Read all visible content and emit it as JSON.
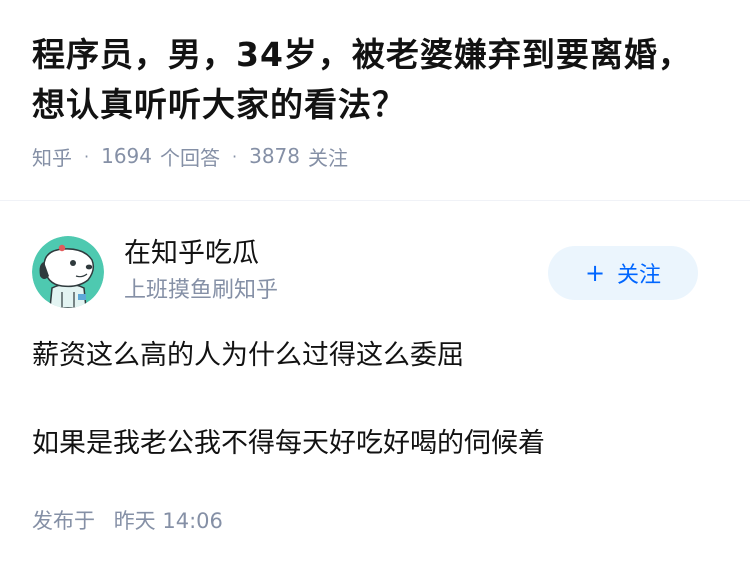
{
  "question": {
    "title": "程序员，男，34岁，被老婆嫌弃到要离婚，想认真听听大家的看法？",
    "meta": {
      "site": "知乎",
      "separator": "·",
      "answers_count": "1694",
      "answers_label": "个回答",
      "followers_count": "3878",
      "followers_label": "关注"
    }
  },
  "author": {
    "name": "在知乎吃瓜",
    "bio": "上班摸鱼刷知乎",
    "avatar_icon": "cartoon-dog-avatar",
    "follow_button": {
      "plus": "+",
      "label": "关注"
    }
  },
  "answer": {
    "paragraphs": [
      "薪资这么高的人为什么过得这么委屈",
      "如果是我老公我不得每天好吃好喝的伺候着"
    ],
    "published_prefix": "发布于",
    "published_time": "昨天 14:06"
  },
  "colors": {
    "title_text": "#121212",
    "meta_text": "#8590a6",
    "follow_bg": "#ebf5fd",
    "follow_text": "#0066ff",
    "avatar_bg": "#4ec9b0"
  }
}
